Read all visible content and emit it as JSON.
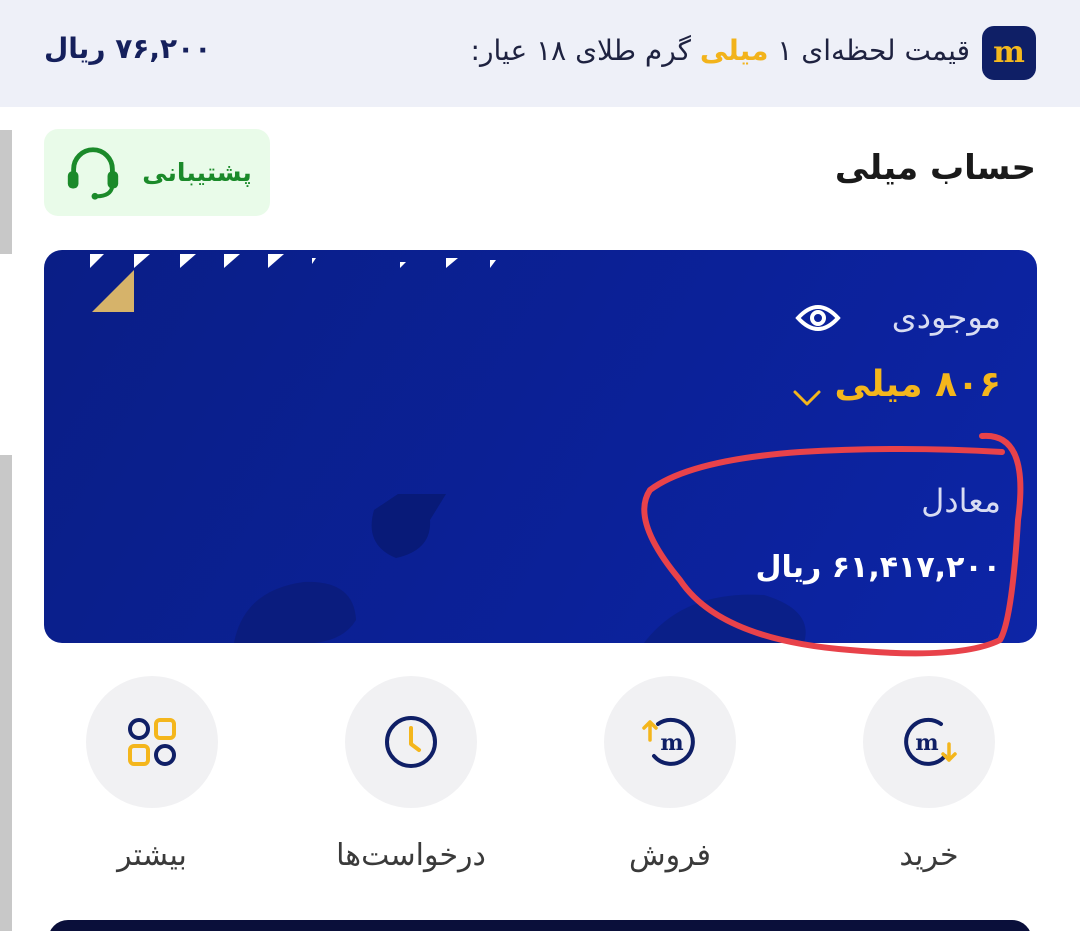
{
  "topbar": {
    "logo_letter": "m",
    "label_prefix": "قیمت لحظه‌ای ۱",
    "label_accent": "میلی",
    "label_suffix": "گرم طلای ۱۸ عیار:",
    "price": "۷۶,۲۰۰ ریال"
  },
  "header": {
    "title": "حساب میلی",
    "support_label": "پشتیبانی"
  },
  "card": {
    "balance_label": "موجودی",
    "balance_value": "۸۰۶ میلی",
    "equivalent_label": "معادل",
    "equivalent_value": "۶۱,۴۱۷,۲۰۰ ریال"
  },
  "actions": [
    {
      "label": "خرید",
      "icon": "buy-icon"
    },
    {
      "label": "فروش",
      "icon": "sell-icon"
    },
    {
      "label": "درخواست‌ها",
      "icon": "clock-icon"
    },
    {
      "label": "بیشتر",
      "icon": "grid-icon"
    }
  ],
  "colors": {
    "navy": "#0f1f66",
    "card_blue": "#0b2199",
    "gold": "#f4b61c",
    "support_green": "#1b8a2a",
    "annotation_red": "#e8424a"
  }
}
